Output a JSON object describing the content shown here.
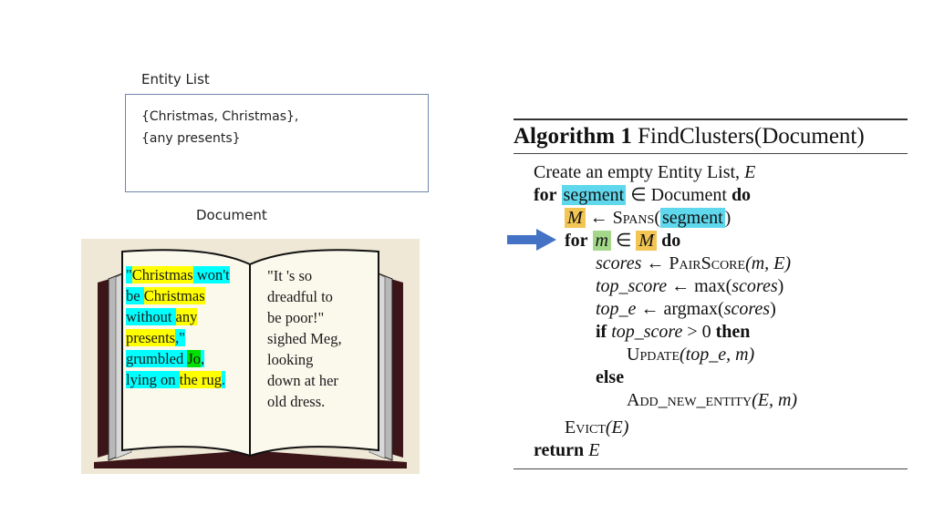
{
  "entity_list": {
    "title": "Entity List",
    "lines": [
      "{Christmas, Christmas},",
      "{any presents}"
    ]
  },
  "document": {
    "title": "Document",
    "left_page": [
      [
        {
          "t": "\"",
          "h": "c"
        },
        {
          "t": "Christmas",
          "h": "y"
        },
        {
          "t": " won't",
          "h": "c"
        }
      ],
      [
        {
          "t": "be ",
          "h": "c"
        },
        {
          "t": "Christmas",
          "h": "y"
        },
        {
          "t": " ",
          "h": "c"
        }
      ],
      [
        {
          "t": "without ",
          "h": "c"
        },
        {
          "t": "any",
          "h": "y"
        }
      ],
      [
        {
          "t": "presents",
          "h": "y"
        },
        {
          "t": ",\"",
          "h": "c"
        }
      ],
      [
        {
          "t": "grumbled ",
          "h": "c"
        },
        {
          "t": "Jo",
          "h": "g"
        },
        {
          "t": ",",
          "h": "c"
        }
      ],
      [
        {
          "t": "lying on ",
          "h": "c"
        },
        {
          "t": "the rug",
          "h": "y"
        },
        {
          "t": ".",
          "h": "c"
        }
      ]
    ],
    "right_page": [
      "\"It 's so",
      "dreadful to",
      "be poor!\"",
      "sighed Meg,",
      "looking",
      "down at her",
      "old dress."
    ]
  },
  "highlight_colors": {
    "y": "#ffff00",
    "c": "#00ffff",
    "g": "#00e000",
    "segment": "#5fd7ec",
    "M": "#f3c654",
    "m": "#a3d88a",
    "arrow": "#4472c4"
  },
  "algorithm": {
    "label": "Algorithm 1",
    "name": "FindClusters(Document)",
    "lines": {
      "l1": "Create an empty Entity List, ",
      "E": "E",
      "for": "for",
      "segment": "segment",
      "in_doc": " ∈ Document ",
      "do": "do",
      "M": "M",
      "larrow": " ← ",
      "spans": "Spans",
      "m": "m",
      "in": " ∈ ",
      "scores": "scores",
      "pairscore": "PairScore",
      "m_E": "(m, E)",
      "top_score": "top_score",
      "max": "max",
      "top_e": "top_e",
      "argmax": "argmax",
      "if": "if",
      "gt0": " > 0 ",
      "then": "then",
      "update": "Update",
      "update_args": "(top_e, m)",
      "else": "else",
      "add_new_entity": "Add_new_entity",
      "add_args": "(E, m)",
      "evict": "Evict",
      "evict_args": "(E)",
      "return": "return"
    }
  }
}
